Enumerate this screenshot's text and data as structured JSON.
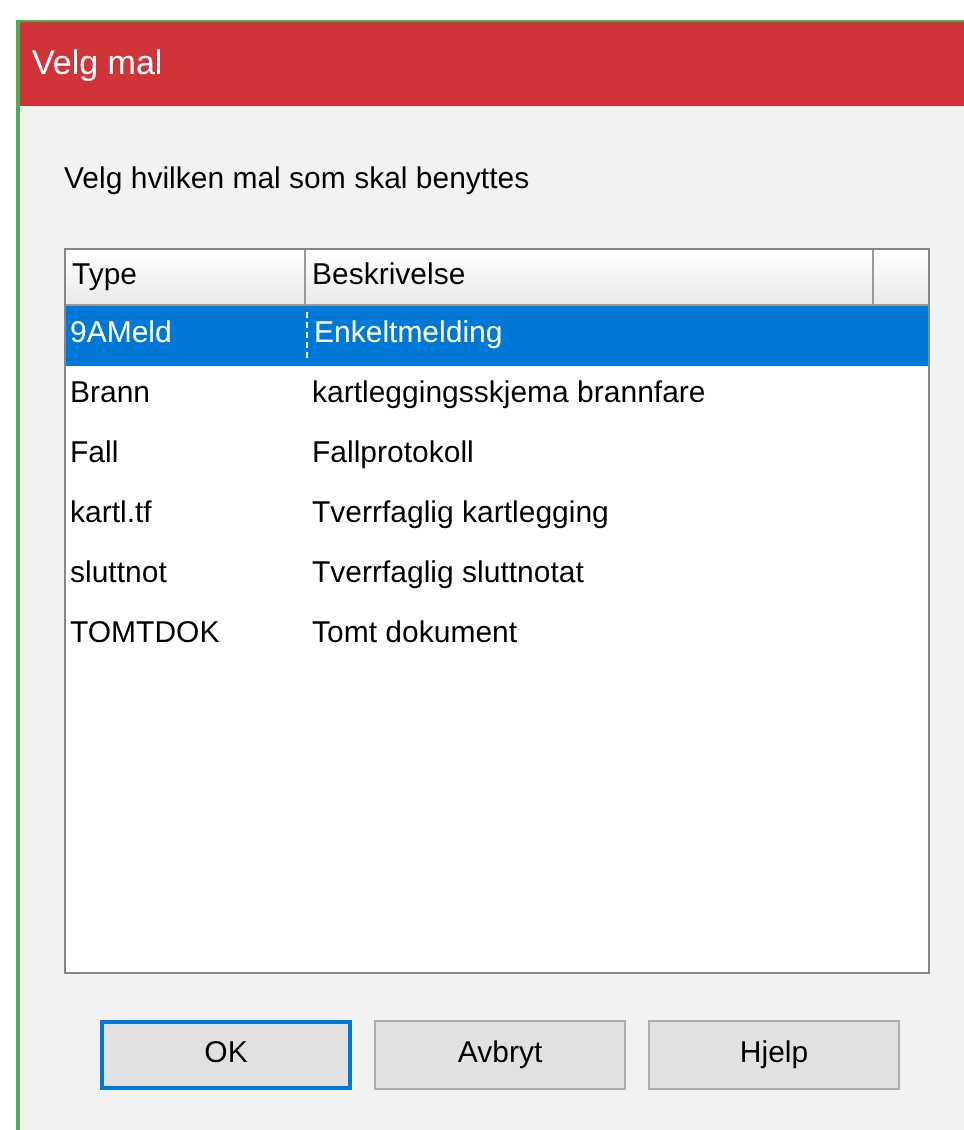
{
  "window": {
    "title": "Velg mal"
  },
  "instruction": "Velg hvilken mal som skal benyttes",
  "table": {
    "columns": [
      "Type",
      "Beskrivelse"
    ],
    "rows": [
      {
        "type": "9AMeld",
        "description": "Enkeltmelding",
        "selected": true
      },
      {
        "type": "Brann",
        "description": "kartleggingsskjema brannfare",
        "selected": false
      },
      {
        "type": "Fall",
        "description": "Fallprotokoll",
        "selected": false
      },
      {
        "type": "kartl.tf",
        "description": "Tverrfaglig kartlegging",
        "selected": false
      },
      {
        "type": "sluttnot",
        "description": "Tverrfaglig sluttnotat",
        "selected": false
      },
      {
        "type": "TOMTDOK",
        "description": "Tomt dokument",
        "selected": false
      }
    ]
  },
  "buttons": [
    {
      "label": "OK",
      "default": true
    },
    {
      "label": "Avbryt",
      "default": false
    },
    {
      "label": "Hjelp",
      "default": false
    }
  ]
}
